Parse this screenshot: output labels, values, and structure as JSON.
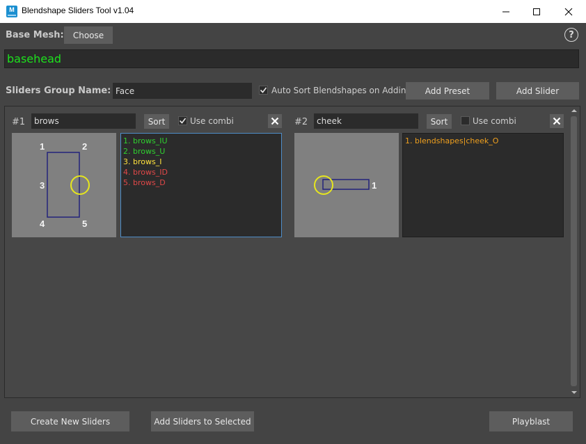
{
  "window": {
    "title": "Blendshape Sliders Tool v1.04",
    "icon_letter": "M"
  },
  "base_mesh": {
    "label": "Base Mesh:",
    "choose_label": "Choose",
    "value": "basehead"
  },
  "help": {
    "icon": "question-circle-icon",
    "glyph": "?"
  },
  "group": {
    "label": "Sliders Group Name:",
    "value": "Face",
    "auto_sort_label": "Auto Sort Blendshapes on Adding",
    "auto_sort_checked": true,
    "add_preset_label": "Add Preset",
    "add_slider_label": "Add Slider"
  },
  "sliders": [
    {
      "number": "#1",
      "name": "brows",
      "sort_label": "Sort",
      "use_combi_label": "Use combi",
      "use_combi_checked": true,
      "points": [
        "1",
        "2",
        "3",
        "4",
        "5"
      ],
      "items": [
        {
          "text": "1. brows_IU",
          "color": "#2fd12f"
        },
        {
          "text": "2. brows_U",
          "color": "#2fd12f"
        },
        {
          "text": "3. brows_I",
          "color": "#ffe23d"
        },
        {
          "text": "4. brows_ID",
          "color": "#e04848"
        },
        {
          "text": "5. brows_D",
          "color": "#e04848"
        }
      ]
    },
    {
      "number": "#2",
      "name": "cheek",
      "sort_label": "Sort",
      "use_combi_label": "Use combi",
      "use_combi_checked": false,
      "points": [
        "1"
      ],
      "items": [
        {
          "text": "1. blendshapes|cheek_O",
          "color": "#f0a01e"
        }
      ]
    }
  ],
  "footer": {
    "create_label": "Create New Sliders",
    "add_selected_label": "Add Sliders to Selected",
    "playblast_label": "Playblast"
  },
  "colors": {
    "background": "#444444",
    "field": "#2b2b2b",
    "button": "#5d5d5d",
    "mesh_text": "#1de11d",
    "handle": "#e6e61e",
    "shape_outline": "#22227a"
  }
}
